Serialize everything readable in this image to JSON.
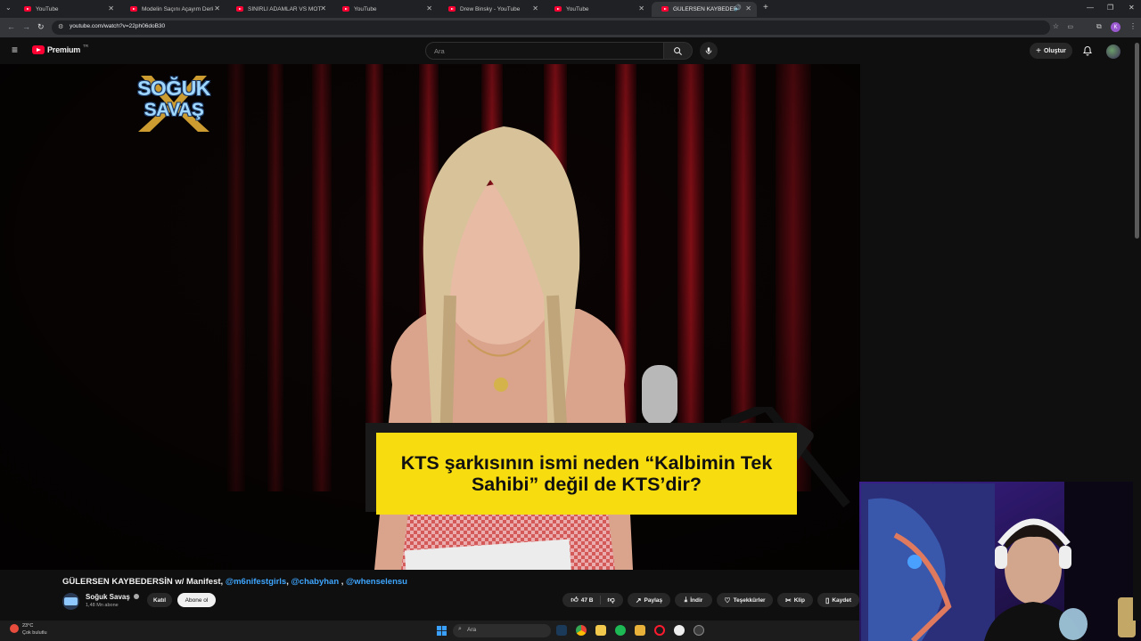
{
  "browser": {
    "tabs": [
      {
        "title": "YouTube",
        "active": false
      },
      {
        "title": "Modelin Saçını Açayım Derken...",
        "active": false
      },
      {
        "title": "SİNİRLİ ADAMLAR VS MOTORCU",
        "active": false
      },
      {
        "title": "YouTube",
        "active": false
      },
      {
        "title": "Drew Binsky - YouTube",
        "active": false
      },
      {
        "title": "YouTube",
        "active": false
      },
      {
        "title": "GÜLERSEN KAYBEDERSİN w/",
        "active": true
      }
    ],
    "url": "youtube.com/watch?v=22ph06doB30",
    "profile_initial": "K"
  },
  "masthead": {
    "logo_label": "Premium",
    "region": "TR",
    "search_placeholder": "Ara",
    "create_label": "Oluştur"
  },
  "video": {
    "show_logo": {
      "line1": "SOĞUK",
      "line2": "SAVAŞ"
    },
    "subtitle_line1": "KTS şarkısının ismi neden “Kalbimin Tek",
    "subtitle_line2": "Sahibi” değil de KTS’dir?"
  },
  "info": {
    "title_main": "GÜLERSEN KAYBEDERSİN w/ Manifest, ",
    "mentions": [
      "@m6nifestgirls",
      "@chabyhan",
      "@whenselensu"
    ],
    "channel_name": "Soğuk Savaş",
    "subscribers": "1,48 Mn abone",
    "join_label": "Katıl",
    "subscribe_label": "Abone ol",
    "actions": {
      "likes": "47 B",
      "share": "Paylaş",
      "download": "İndir",
      "thanks": "Teşekkürler",
      "clip": "Klip",
      "save": "Kaydet"
    }
  },
  "taskbar": {
    "temperature": "23°C",
    "weather": "Çok bulutlu",
    "search_placeholder": "Ara"
  },
  "colors": {
    "youtube_red": "#ff0033",
    "subtitle_yellow": "#f7dc0f",
    "link_blue": "#3ea6ff",
    "curtain_red": "#a0121c"
  }
}
